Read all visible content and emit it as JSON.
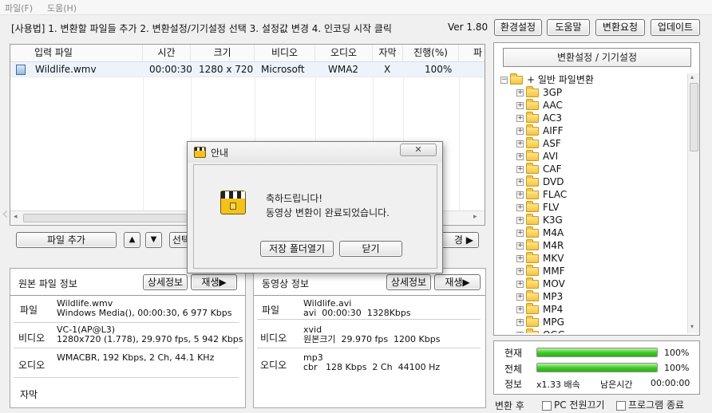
{
  "menu": {
    "file": "파일(F)",
    "help": "도움(H)"
  },
  "toolbar": {
    "usage": "[사용법] 1. 변환할 파일들 추가   2. 변환설정/기기설정 선택   3. 설정값 변경   4. 인코딩 시작 클릭",
    "version": "Ver 1.80",
    "buttons": [
      "환경설정",
      "도움말",
      "변환요청",
      "업데이트"
    ]
  },
  "filelist": {
    "columns": [
      "입력 파일",
      "시간",
      "크기",
      "비디오",
      "오디오",
      "자막",
      "진행(%)",
      "파"
    ],
    "rows": [
      [
        "Wildlife.wmv",
        "00:00:30",
        "1280 x 720",
        "Microsoft",
        "WMA2",
        "X",
        "100%"
      ]
    ]
  },
  "listbar": {
    "add_file": "파일 추가",
    "up": "▲",
    "down": "▼",
    "select_partial": "선택",
    "right_partial": "경 ▶"
  },
  "source_panel": {
    "title": "원본 파일 정보",
    "detail_button": "상세정보",
    "play_button": "재생▶",
    "rows": [
      {
        "label": "파일",
        "value": "Wildlife.wmv\nWindows Media(), 00:00:30, 6 977 Kbps"
      },
      {
        "label": "비디오",
        "value": "VC-1(AP@L3)\n1280x720 (1.778), 29.970 fps, 5 942 Kbps"
      },
      {
        "label": "오디오",
        "value": "WMACBR, 192 Kbps, 2 Ch, 44.1 KHz"
      },
      {
        "label": "자막",
        "value": ""
      }
    ]
  },
  "output_panel": {
    "title": "동영상 정보",
    "detail_button": "상세정보",
    "play_button": "재생▶",
    "rows": [
      {
        "label": "파일",
        "value": "Wildlife.avi\navi  00:00:30  1328Kbps"
      },
      {
        "label": "비디오",
        "value": "xvid\n원본크기  29.970 fps  1200 Kbps"
      },
      {
        "label": "오디오",
        "value": "mp3\ncbr   128 Kbps  2 Ch  44100 Hz"
      }
    ]
  },
  "settings": {
    "title": "변환설정 / 기기설정",
    "root": "+ 일반 파일변환",
    "items": [
      "3GP",
      "AAC",
      "AC3",
      "AIFF",
      "ASF",
      "AVI",
      "CAF",
      "DVD",
      "FLAC",
      "FLV",
      "K3G",
      "M4A",
      "M4R",
      "MKV",
      "MMF",
      "MOV",
      "MP3",
      "MP4",
      "MPG",
      "OGG"
    ]
  },
  "progress": {
    "current_label": "현재",
    "current_value": "100%",
    "current_fraction": 1.0,
    "total_label": "전체",
    "total_value": "100%",
    "total_fraction": 1.0,
    "info_label": "정보",
    "speed": "x1.33 배속",
    "remaining_label": "남은시간",
    "remaining": "00:00:00"
  },
  "after": {
    "label": "변환 후",
    "power_off": "PC 전원끄기",
    "exit": "프로그램 종료"
  },
  "dialog": {
    "title": "안내",
    "line1": "축하드립니다!",
    "line2": "동영상 변환이 완료되었습니다.",
    "open_folder": "저장 폴더열기",
    "close": "닫기"
  },
  "colors": {
    "progress": "#3dc825",
    "folder": "#f4c543",
    "row_highlight": "#eef3fb"
  }
}
